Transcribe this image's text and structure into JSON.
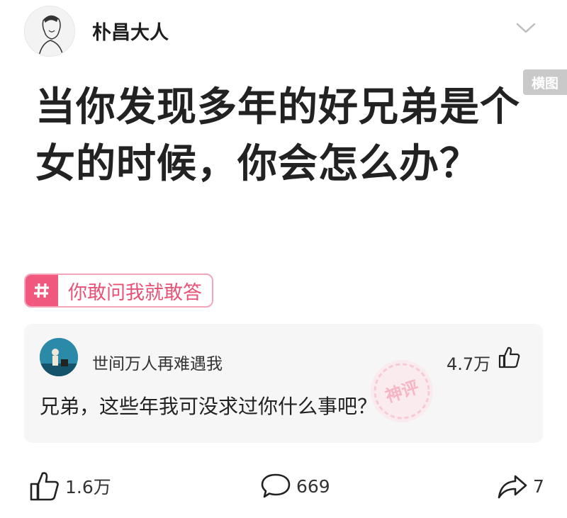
{
  "post": {
    "author": "朴昌大人",
    "landscape_label": "横图",
    "title": "当你发现多年的好兄弟是个女的时候，你会怎么办？",
    "topic": {
      "hash_symbol": "#",
      "label": "你敢问我就敢答"
    }
  },
  "top_comment": {
    "author": "世间万人再难遇我",
    "likes": "4.7万",
    "text": "兄弟，这些年我可没求过你什么事吧？",
    "stamp_text": "神评"
  },
  "actions": {
    "likes": "1.6万",
    "comments": "669",
    "shares": "7"
  },
  "icons": {
    "chevron": "chevron-down-icon",
    "like": "thumbs-up-icon",
    "comment": "speech-bubble-icon",
    "share": "share-arrow-icon"
  },
  "colors": {
    "accent_pink": "#f0587d",
    "tag_border": "#f3a6b9",
    "card_bg": "#f6f6f6",
    "landscape_bg": "#c9c9c9"
  }
}
